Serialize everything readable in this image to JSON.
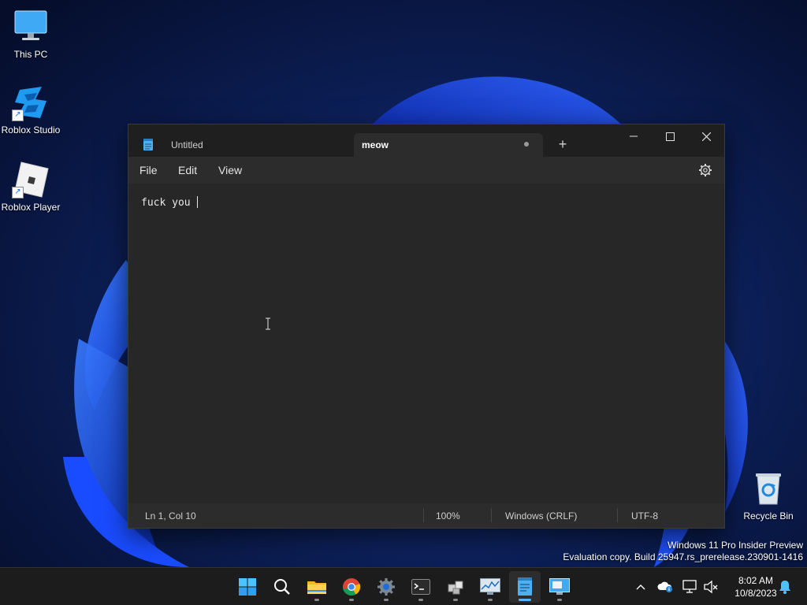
{
  "desktop": {
    "icons": [
      {
        "label": "This PC",
        "icon": "monitor-icon"
      },
      {
        "label": "Roblox Studio",
        "icon": "roblox-studio-icon"
      },
      {
        "label": "Roblox Player",
        "icon": "roblox-player-icon"
      },
      {
        "label": "Recycle Bin",
        "icon": "recycle-bin-icon"
      }
    ]
  },
  "notepad": {
    "tabs": [
      {
        "label": "Untitled",
        "active": false
      },
      {
        "label": "meow",
        "active": true,
        "unsaved": true
      }
    ],
    "new_tab_symbol": "+",
    "menu": {
      "file": "File",
      "edit": "Edit",
      "view": "View"
    },
    "content": "fuck you ",
    "status": {
      "position": "Ln 1, Col 10",
      "zoom": "100%",
      "line_ending": "Windows (CRLF)",
      "encoding": "UTF-8"
    }
  },
  "watermark": {
    "line1": "Windows 11 Pro Insider Preview",
    "line2": "Evaluation copy. Build 25947.rs_prerelease.230901-1416"
  },
  "taskbar": {
    "apps": [
      {
        "name": "start-button",
        "icon": "windows-logo-icon"
      },
      {
        "name": "search-button",
        "icon": "search-icon"
      },
      {
        "name": "file-explorer",
        "icon": "folder-icon"
      },
      {
        "name": "chrome",
        "icon": "chrome-icon"
      },
      {
        "name": "settings",
        "icon": "gear-icon"
      },
      {
        "name": "terminal",
        "icon": "terminal-icon"
      },
      {
        "name": "roblox-studio-app",
        "icon": "roblox-studio-icon"
      },
      {
        "name": "resource-monitor",
        "icon": "monitor-chart-icon"
      },
      {
        "name": "notepad",
        "icon": "notepad-icon",
        "active": true
      },
      {
        "name": "remote-desktop",
        "icon": "remote-desktop-icon"
      }
    ],
    "clock": {
      "time": "8:02 AM",
      "date": "10/8/2023"
    }
  },
  "colors": {
    "accent": "#5fb2f2",
    "window_bg": "#272727",
    "titlebar_bg": "#1f1f1f",
    "taskbar_bg": "#1c1c1c"
  }
}
